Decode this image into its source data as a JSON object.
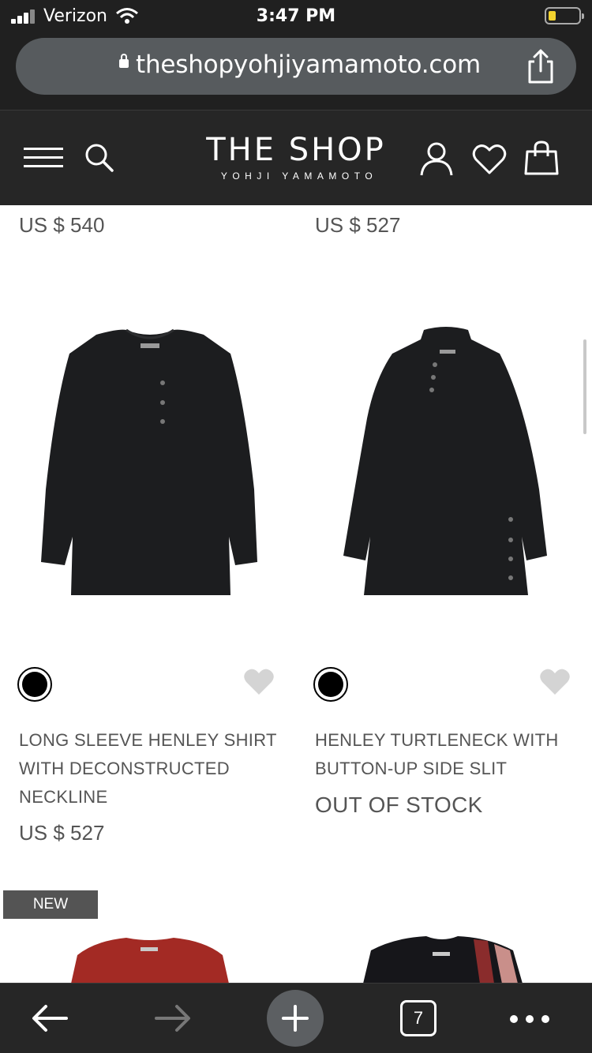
{
  "status_bar": {
    "carrier": "Verizon",
    "time": "3:47 PM"
  },
  "url_bar": {
    "url": "theshopyohjiyamamoto.com"
  },
  "header": {
    "logo_main": "THE SHOP",
    "logo_sub": "YOHJI YAMAMOTO"
  },
  "products": {
    "top_prices": [
      "US $ 540",
      "US $ 527"
    ],
    "items": [
      {
        "name": "LONG SLEEVE HENLEY SHIRT WITH DECONSTRUCTED NECKLINE",
        "price": "US $ 527",
        "swatch_color": "#000000"
      },
      {
        "name": "HENLEY TURTLENECK WITH BUTTON-UP SIDE SLIT",
        "status": "OUT OF STOCK",
        "swatch_color": "#000000"
      }
    ],
    "next_row": {
      "badge": "NEW"
    }
  },
  "toolbar": {
    "tab_count": "7"
  },
  "colors": {
    "chrome": "#262626",
    "url_pill": "#575b5e",
    "text_gray": "#555555",
    "badge": "#545454"
  }
}
